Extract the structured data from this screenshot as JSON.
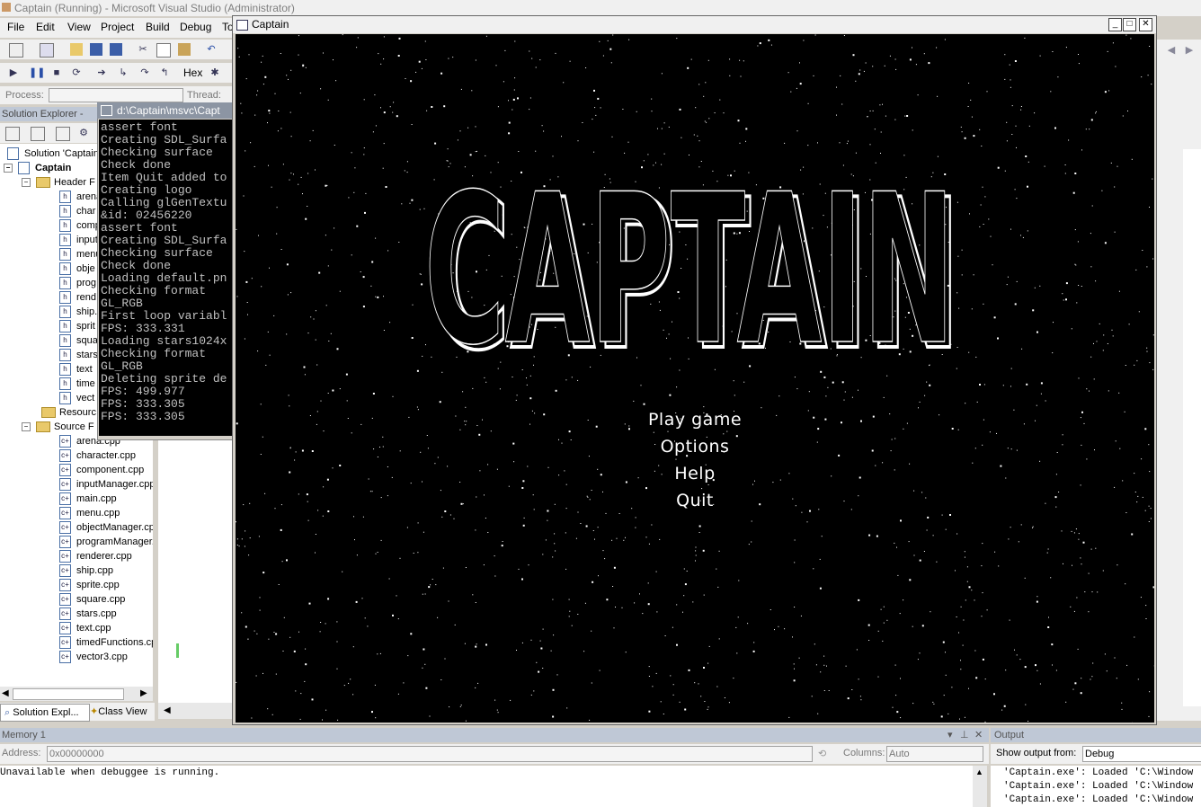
{
  "vs": {
    "title": "Captain (Running) - Microsoft Visual Studio (Administrator)",
    "menu": [
      "File",
      "Edit",
      "View",
      "Project",
      "Build",
      "Debug",
      "To"
    ],
    "hex_label": "Hex",
    "process_label": "Process:",
    "thread_label": "Thread:"
  },
  "solution_explorer": {
    "header": "Solution Explorer - Sol",
    "solution_label": "Solution 'Captain'",
    "project_label": "Captain",
    "header_folder": "Header F",
    "header_files": [
      "arena",
      "char",
      "comp",
      "input",
      "menu",
      "obje",
      "prog",
      "rend",
      "ship.",
      "sprit",
      "squa",
      "stars",
      "text",
      "time",
      "vect"
    ],
    "resource_folder": "Resourc",
    "source_folder": "Source F",
    "source_files": [
      "arena.cpp",
      "character.cpp",
      "component.cpp",
      "inputManager.cpp",
      "main.cpp",
      "menu.cpp",
      "objectManager.cp",
      "programManager.",
      "renderer.cpp",
      "ship.cpp",
      "sprite.cpp",
      "square.cpp",
      "stars.cpp",
      "text.cpp",
      "timedFunctions.cp",
      "vector3.cpp"
    ],
    "tab_solution": "Solution Expl...",
    "tab_class": "Class View"
  },
  "console": {
    "title": "d:\\Captain\\msvc\\Capt",
    "lines": [
      "assert font",
      "Creating SDL_Surfa",
      "Checking surface",
      "Check done",
      "Item Quit added to",
      "Creating logo",
      "Calling glGenTextu",
      "&id: 02456220",
      "assert font",
      "Creating SDL_Surfa",
      "Checking surface",
      "Check done",
      "Loading default.pn",
      "Checking format",
      "GL_RGB",
      "First loop variabl",
      "FPS: 333.331",
      "Loading stars1024x",
      "Checking format",
      "GL_RGB",
      "Deleting sprite de",
      "FPS: 499.977",
      "FPS: 333.305",
      "FPS: 333.305"
    ]
  },
  "game": {
    "window_title": "Captain",
    "logo_text": "CAPTAIN",
    "menu": [
      "Play game",
      "Options",
      "Help",
      "Quit"
    ]
  },
  "memory": {
    "title": "Memory 1",
    "address_label": "Address:",
    "address_value": "0x00000000",
    "columns_label": "Columns:",
    "columns_value": "Auto",
    "message": "Unavailable when debuggee is running."
  },
  "output": {
    "title": "Output",
    "show_from_label": "Show output from:",
    "show_from_value": "Debug",
    "lines": [
      "'Captain.exe': Loaded 'C:\\Window",
      "'Captain.exe': Loaded 'C:\\Window",
      "'Captain.exe': Loaded 'C:\\Window"
    ]
  }
}
